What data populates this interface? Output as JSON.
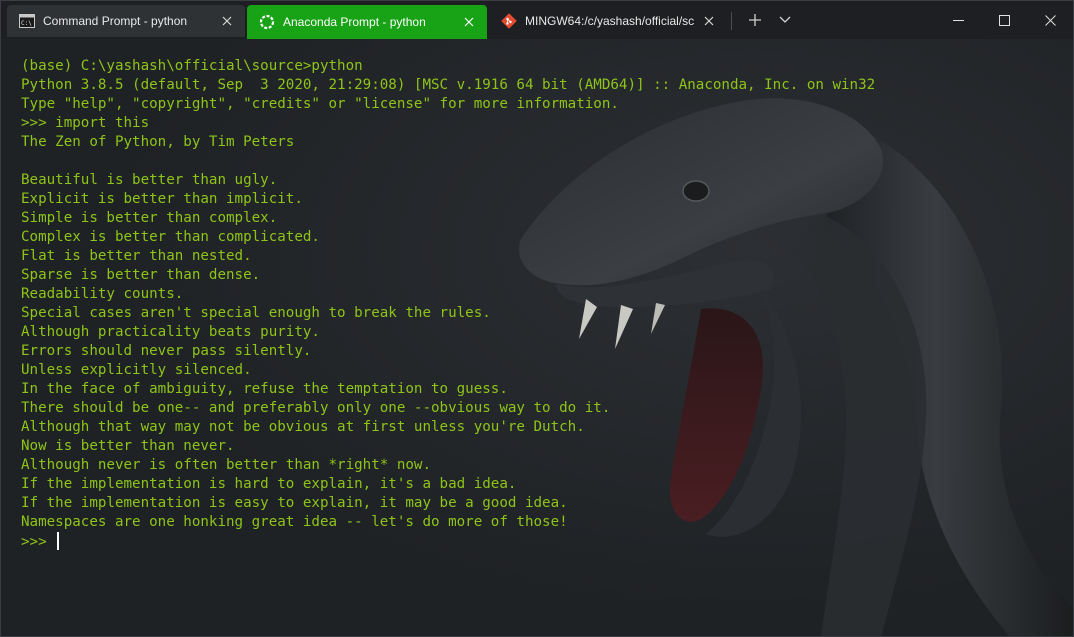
{
  "tabs": [
    {
      "title": "Command Prompt - python",
      "icon": "cmd-icon",
      "active": false
    },
    {
      "title": "Anaconda Prompt - python",
      "icon": "anaconda-icon",
      "active": true,
      "accent": "#17a315"
    },
    {
      "title": "MINGW64:/c/yashash/official/sc",
      "icon": "git-icon",
      "active": false
    }
  ],
  "tab_actions": {
    "new_tab": "new-tab-icon",
    "dropdown": "chevron-down-icon"
  },
  "window_controls": [
    "minimize-icon",
    "maximize-icon",
    "close-icon"
  ],
  "terminal": {
    "text_color": "#8ec418",
    "lines": [
      "(base) C:\\yashash\\official\\source>python",
      "Python 3.8.5 (default, Sep  3 2020, 21:29:08) [MSC v.1916 64 bit (AMD64)] :: Anaconda, Inc. on win32",
      "Type \"help\", \"copyright\", \"credits\" or \"license\" for more information.",
      ">>> import this",
      "The Zen of Python, by Tim Peters",
      "",
      "Beautiful is better than ugly.",
      "Explicit is better than implicit.",
      "Simple is better than complex.",
      "Complex is better than complicated.",
      "Flat is better than nested.",
      "Sparse is better than dense.",
      "Readability counts.",
      "Special cases aren't special enough to break the rules.",
      "Although practicality beats purity.",
      "Errors should never pass silently.",
      "Unless explicitly silenced.",
      "In the face of ambiguity, refuse the temptation to guess.",
      "There should be one-- and preferably only one --obvious way to do it.",
      "Although that way may not be obvious at first unless you're Dutch.",
      "Now is better than never.",
      "Although never is often better than *right* now.",
      "If the implementation is hard to explain, it's a bad idea.",
      "If the implementation is easy to explain, it may be a good idea.",
      "Namespaces are one honking great idea -- let's do more of those!"
    ],
    "prompt": ">>> "
  }
}
